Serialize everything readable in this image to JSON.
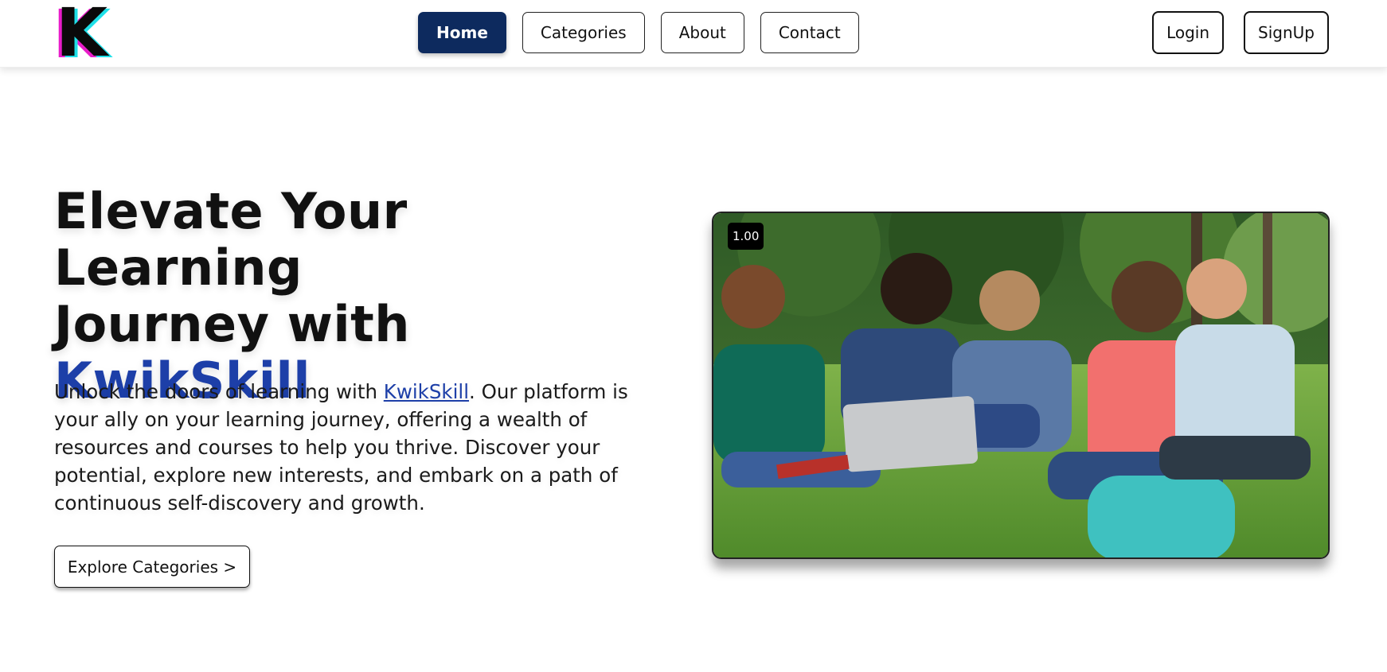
{
  "header": {
    "logo_letter": "K",
    "nav": [
      {
        "label": "Home",
        "active": true
      },
      {
        "label": "Categories",
        "active": false
      },
      {
        "label": "About",
        "active": false
      },
      {
        "label": "Contact",
        "active": false
      }
    ],
    "login_label": "Login",
    "signup_label": "SignUp"
  },
  "hero": {
    "title_line1": "Elevate Your Learning",
    "title_line2": "Journey with",
    "title_brand": "KwikSkill",
    "desc_before": "Unlock the doors of learning with ",
    "desc_link": "KwikSkill",
    "desc_after": ". Our platform is your ally on your learning journey, offering a wealth of resources and courses to help you thrive. Discover your potential, explore new interests, and embark on a path of continuous self-discovery and growth.",
    "cta_label": "Explore Categories >"
  },
  "video": {
    "playback_speed": "1.00"
  },
  "colors": {
    "brand_blue": "#1d3fa8",
    "nav_active": "#0d2a5e",
    "logo_magenta": "#e81cc9",
    "logo_cyan": "#1fe0e8"
  }
}
